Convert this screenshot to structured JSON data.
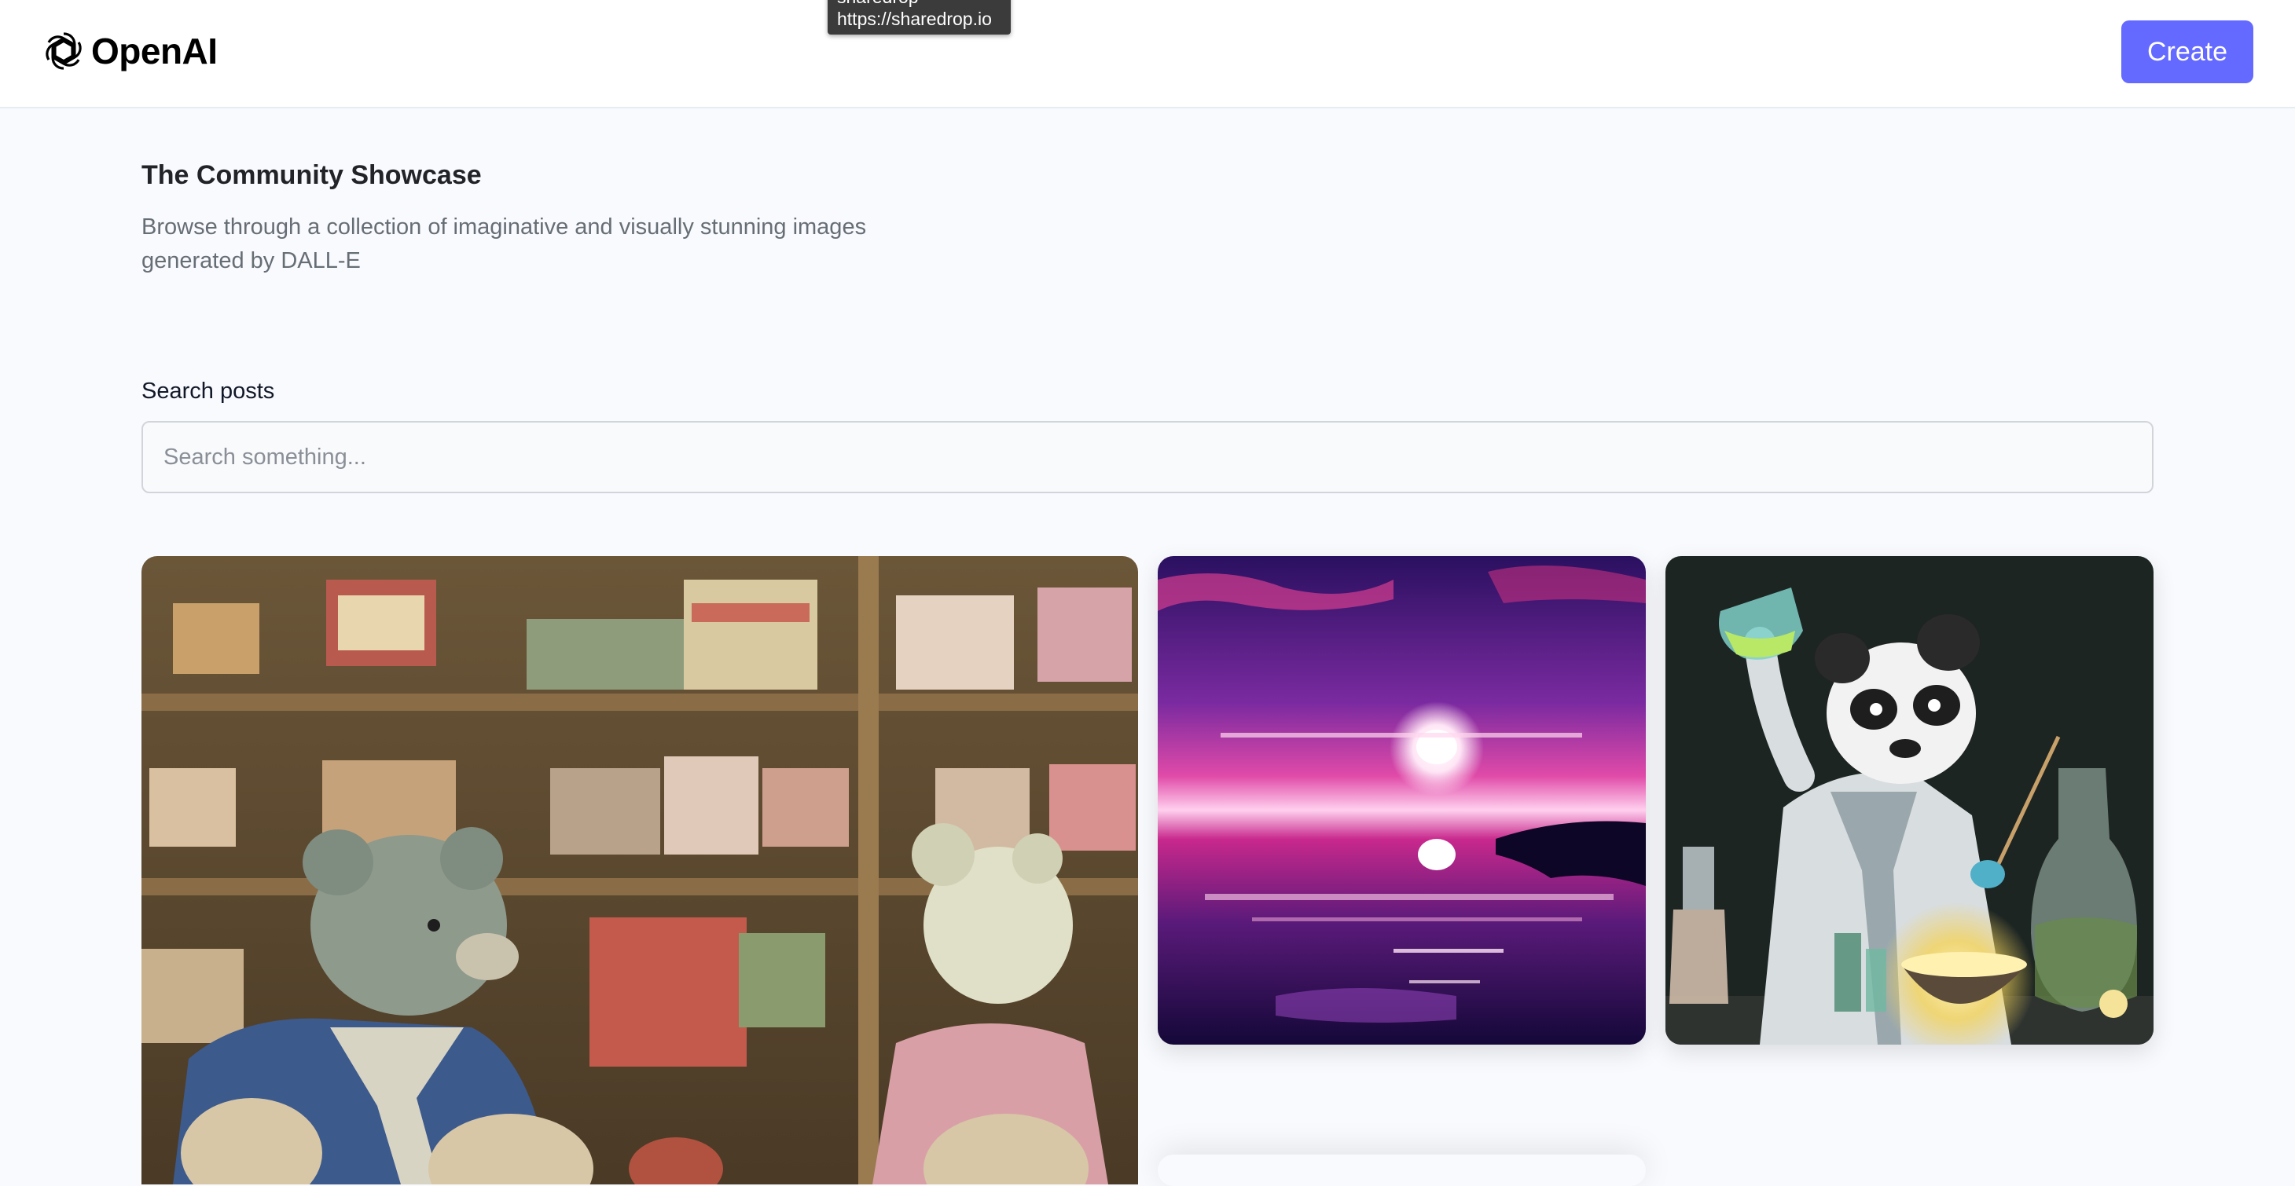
{
  "header": {
    "logo_text": "OpenAI",
    "logo_icon": "openai-logo-icon",
    "create_label": "Create"
  },
  "tooltip": {
    "line1": "sharedrop",
    "line2": "https://sharedrop.io"
  },
  "main": {
    "title": "The Community Showcase",
    "subtitle": "Browse through a collection of imaginative and visually stunning images generated by DALL-E"
  },
  "search": {
    "label": "Search posts",
    "placeholder": "Search something...",
    "value": ""
  },
  "gallery": {
    "cards": [
      {
        "name": "teddy-bears-shop-image"
      },
      {
        "name": "pink-sunset-ocean-image"
      },
      {
        "name": "panda-scientist-image"
      }
    ]
  },
  "colors": {
    "accent": "#6469ff",
    "background": "#f9fafe",
    "header_bg": "#ffffff",
    "title_text": "#222328",
    "subtitle_text": "#666e75"
  }
}
